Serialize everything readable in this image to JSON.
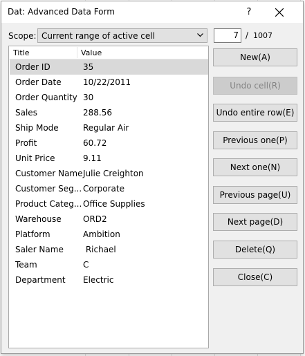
{
  "dialog": {
    "title": "Dat: Advanced Data Form",
    "help_label": "?",
    "scope_label": "Scope:",
    "scope_value": "Current range of active cell",
    "record_current": "7",
    "record_separator": "/",
    "record_total": "1007"
  },
  "columns": {
    "title": "Title",
    "value": "Value"
  },
  "rows": [
    {
      "key": "Order ID",
      "value": "35"
    },
    {
      "key": "Order Date",
      "value": "10/22/2011"
    },
    {
      "key": "Order Quantity",
      "value": "30"
    },
    {
      "key": "Sales",
      "value": "288.56"
    },
    {
      "key": "Ship Mode",
      "value": "Regular Air"
    },
    {
      "key": "Profit",
      "value": "60.72"
    },
    {
      "key": "Unit Price",
      "value": "9.11"
    },
    {
      "key": "Customer Name",
      "value": "Julie Creighton"
    },
    {
      "key": "Customer Seg...",
      "value": "Corporate"
    },
    {
      "key": "Product Categ...",
      "value": "Office Supplies"
    },
    {
      "key": "Warehouse",
      "value": "ORD2"
    },
    {
      "key": "Platform",
      "value": "Ambition"
    },
    {
      "key": "Saler Name",
      "value": " Richael"
    },
    {
      "key": "Team",
      "value": "C"
    },
    {
      "key": "Department",
      "value": "Electric"
    }
  ],
  "buttons": {
    "new": "New(A)",
    "undo_cell": "Undo cell(R)",
    "undo_row": "Undo entire row(E)",
    "previous_one": "Previous one(P)",
    "next_one": "Next one(N)",
    "previous_page": "Previous page(U)",
    "next_page": "Next page(D)",
    "delete": "Delete(Q)",
    "close": "Close(C)"
  }
}
